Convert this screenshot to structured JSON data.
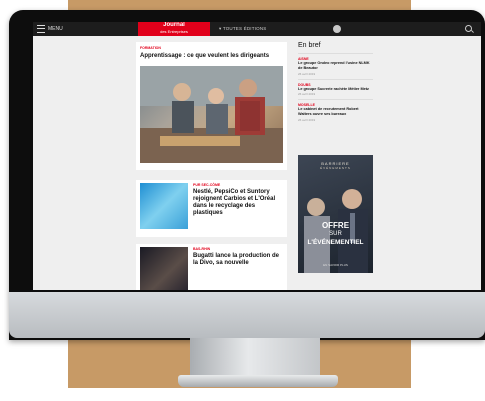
{
  "header": {
    "menu_label": "MENU",
    "logo_text": "Journal",
    "logo_sub": "des Entreprises",
    "editions_label": "TOUTES ÉDITIONS"
  },
  "main_article": {
    "tag": "FORMATION",
    "title": "Apprentissage : ce que veulent les dirigeants"
  },
  "articles": [
    {
      "tag": "PUR SEC-CÔME",
      "title": "Nestlé, PepsiCo et Suntory rejoignent Carbios et L'Oréal dans le recyclage des plastiques"
    },
    {
      "tag": "BAS-RHIN",
      "title": "Bugatti lance la production de la Divo, sa nouvelle"
    }
  ],
  "sidebar": {
    "title": "En bref",
    "items": [
      {
        "tag": "AISNE",
        "text": "Le groupe Ondeo reprend l'usine NLMK de Beautor",
        "date": "26 avril 2019"
      },
      {
        "tag": "DOUBS",
        "text": "Le groupe Sucrerie rachète Métier Metz",
        "date": "26 avril 2019"
      },
      {
        "tag": "MOSELLE",
        "text": "Le cabinet de recrutement Robert Walters ouvre ses bureaux",
        "date": "26 avril 2019"
      }
    ]
  },
  "ad": {
    "brand": "BARRIERE",
    "brand_sub": "ÉVÉNEMENTS",
    "line1": "OFFRE",
    "line2": "SUR",
    "line3": "L'ÉVÉNEMENTIEL",
    "footer": "EN SAVOIR PLUS"
  },
  "colors": {
    "accent": "#e1001a",
    "topbar": "#1d1d1d",
    "page_bg": "#efefef",
    "backdrop": "#c79a66"
  },
  "icons": [
    "menu-icon",
    "user-icon",
    "search-icon"
  ]
}
